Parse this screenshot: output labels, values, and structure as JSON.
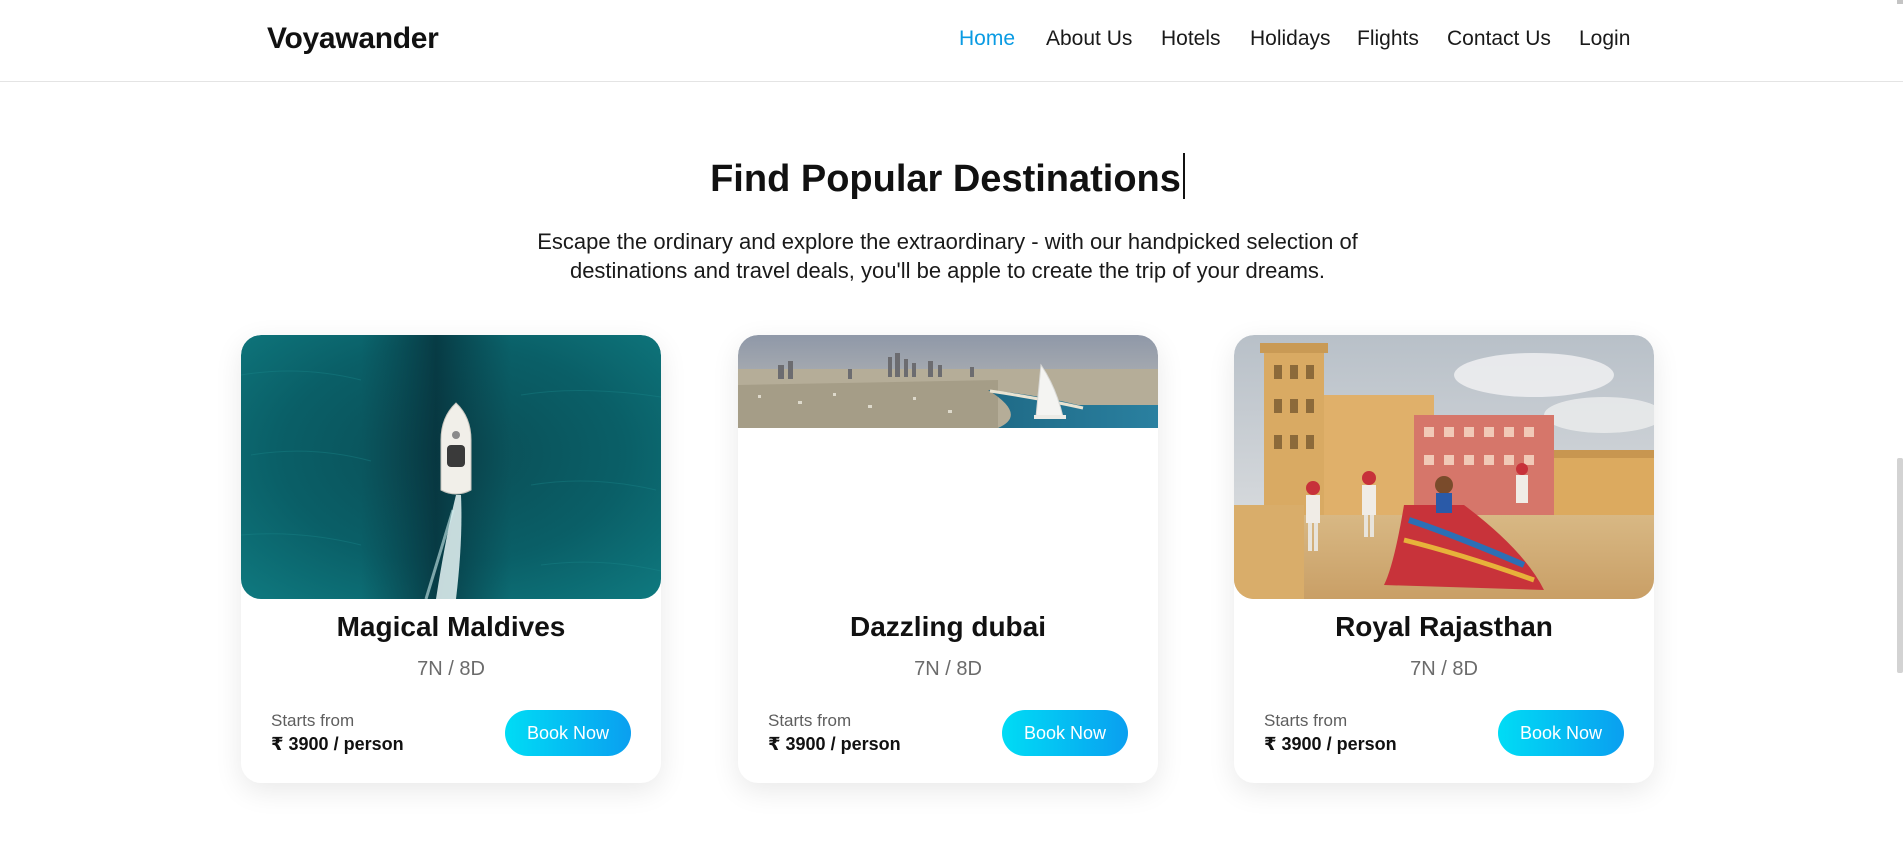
{
  "brand": "Voyawander",
  "nav": [
    {
      "label": "Home",
      "active": true
    },
    {
      "label": "About Us",
      "active": false
    },
    {
      "label": "Hotels",
      "active": false
    },
    {
      "label": "Holidays",
      "active": false
    },
    {
      "label": "Flights",
      "active": false
    },
    {
      "label": "Contact Us",
      "active": false
    },
    {
      "label": "Login",
      "active": false
    }
  ],
  "colors": {
    "accent": "#0a9be3",
    "button_gradient_start": "#00dcf5",
    "button_gradient_end": "#0a9ff0"
  },
  "section": {
    "title": "Find Popular Destinations",
    "subtitle": "Escape the ordinary and explore the extraordinary - with our handpicked selection of destinations and travel deals, you'll be apple to create the trip of your dreams."
  },
  "cards": [
    {
      "title": "Magical Maldives",
      "duration": "7N / 8D",
      "price_label": "Starts from",
      "price": "₹ 3900 / person",
      "button": "Book Now"
    },
    {
      "title": "Dazzling dubai",
      "duration": "7N / 8D",
      "price_label": "Starts from",
      "price": "₹ 3900 / person",
      "button": "Book Now"
    },
    {
      "title": "Royal Rajasthan",
      "duration": "7N / 8D",
      "price_label": "Starts from",
      "price": "₹ 3900 / person",
      "button": "Book Now"
    }
  ]
}
